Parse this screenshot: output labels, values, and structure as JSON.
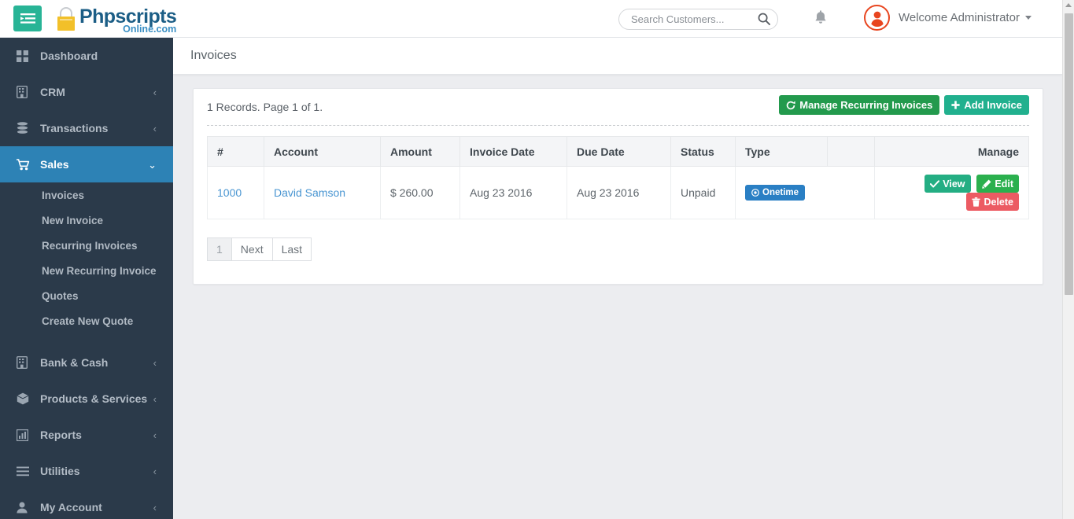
{
  "topbar": {
    "toggle_icon": "sidebar-toggle-icon",
    "logo": {
      "icon": "shopping-bag-icon",
      "main_text": "Phpscripts",
      "sub_text": "Online.com",
      "main_color": "#1c5e86",
      "sub_color": "#3a8fc4",
      "bag_color": "#f2c029"
    },
    "search": {
      "placeholder": "Search Customers...",
      "value": "",
      "icon": "search-icon"
    },
    "notifications_icon": "bell-icon",
    "user": {
      "avatar_icon": "user-avatar-icon",
      "avatar_color": "#e8451f",
      "name": "Welcome Administrator",
      "caret_icon": "caret-down-icon"
    }
  },
  "sidebar": {
    "accent_color": "#2d82b5",
    "background": "#2b3a4a",
    "items": [
      {
        "label": "Dashboard",
        "icon": "dashboard-grid-icon",
        "expandable": false,
        "active": false
      },
      {
        "label": "CRM",
        "icon": "building-icon",
        "expandable": true,
        "active": false
      },
      {
        "label": "Transactions",
        "icon": "database-icon",
        "expandable": true,
        "active": false
      },
      {
        "label": "Sales",
        "icon": "shopping-cart-icon",
        "expandable": true,
        "active": true
      },
      {
        "label": "Bank & Cash",
        "icon": "bank-icon",
        "expandable": true,
        "active": false
      },
      {
        "label": "Products & Services",
        "icon": "box-icon",
        "expandable": true,
        "active": false
      },
      {
        "label": "Reports",
        "icon": "bar-chart-icon",
        "expandable": true,
        "active": false
      },
      {
        "label": "Utilities",
        "icon": "list-icon",
        "expandable": true,
        "active": false
      },
      {
        "label": "My Account",
        "icon": "user-icon",
        "expandable": true,
        "active": false
      }
    ],
    "sales_submenu": [
      {
        "label": "Invoices"
      },
      {
        "label": "New Invoice"
      },
      {
        "label": "Recurring Invoices"
      },
      {
        "label": "New Recurring Invoice"
      },
      {
        "label": "Quotes"
      },
      {
        "label": "Create New Quote"
      }
    ]
  },
  "page": {
    "title": "Invoices",
    "records_text": "1 Records. Page 1 of 1.",
    "manage_recurring_label": "Manage Recurring Invoices",
    "manage_recurring_icon": "refresh-icon",
    "add_invoice_label": "Add Invoice",
    "add_invoice_icon": "plus-icon"
  },
  "table": {
    "columns": [
      "#",
      "Account",
      "Amount",
      "Invoice Date",
      "Due Date",
      "Status",
      "Type",
      "",
      "Manage"
    ],
    "rows": [
      {
        "number": "1000",
        "account": "David Samson",
        "amount": "$ 260.00",
        "invoice_date": "Aug 23 2016",
        "due_date": "Aug 23 2016",
        "status": "Unpaid",
        "type": "Onetime",
        "type_icon": "circle-dot-icon",
        "actions": [
          {
            "label": "View",
            "icon": "check-icon",
            "color": "#24ae83"
          },
          {
            "label": "Edit",
            "icon": "pencil-icon",
            "color": "#2bb04e"
          },
          {
            "label": "Delete",
            "icon": "trash-icon",
            "color": "#ec5b63"
          }
        ]
      }
    ]
  },
  "pagination": [
    {
      "label": "1",
      "current": true
    },
    {
      "label": "Next",
      "current": false
    },
    {
      "label": "Last",
      "current": false
    }
  ]
}
